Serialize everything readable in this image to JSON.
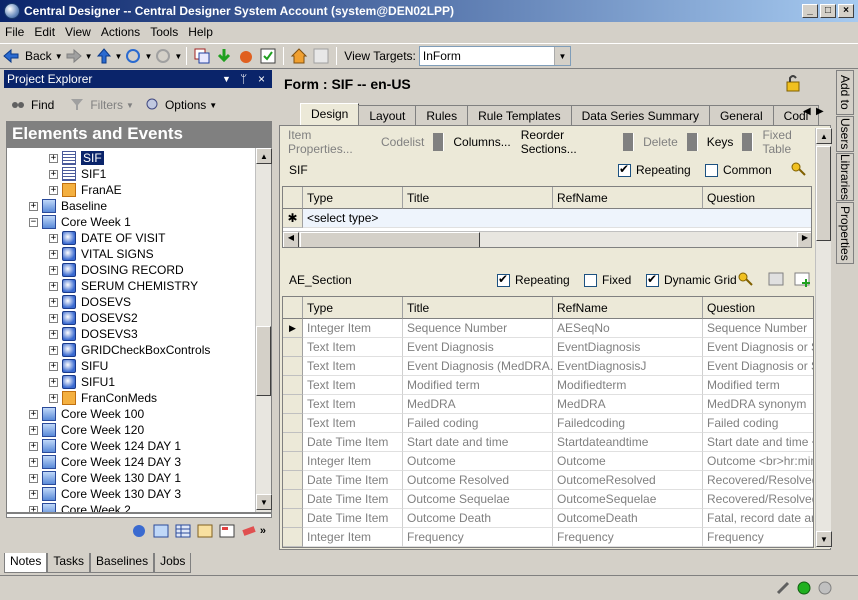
{
  "window": {
    "title": "Central Designer -- Central Designer System Account (system@DEN02LPP)",
    "minimize": "_",
    "maximize": "□",
    "close": "×"
  },
  "menu": [
    "File",
    "Edit",
    "View",
    "Actions",
    "Tools",
    "Help"
  ],
  "toolbar": {
    "back_label": "Back",
    "view_targets_label": "View Targets:",
    "view_targets_value": "InForm"
  },
  "project_explorer": {
    "title": "Project Explorer",
    "find_label": "Find",
    "filters_label": "Filters",
    "options_label": "Options",
    "section_title": "Elements and Events",
    "tree": [
      {
        "label": "SIF",
        "icon": "form-icon",
        "depth": 2,
        "selected": true
      },
      {
        "label": "SIF1",
        "icon": "form-icon",
        "depth": 2
      },
      {
        "label": "FranAE",
        "icon": "ae-icon",
        "depth": 2
      },
      {
        "label": "Baseline",
        "icon": "event-icon",
        "depth": 1
      },
      {
        "label": "Core Week 1",
        "icon": "event-icon",
        "depth": 1,
        "expanded": true
      },
      {
        "label": "DATE OF VISIT",
        "icon": "section-icon",
        "depth": 2
      },
      {
        "label": "VITAL SIGNS",
        "icon": "section-icon",
        "depth": 2
      },
      {
        "label": "DOSING RECORD",
        "icon": "section-icon",
        "depth": 2
      },
      {
        "label": "SERUM CHEMISTRY",
        "icon": "section-icon",
        "depth": 2
      },
      {
        "label": "DOSEVS",
        "icon": "section-icon",
        "depth": 2
      },
      {
        "label": "DOSEVS2",
        "icon": "section-icon",
        "depth": 2
      },
      {
        "label": "DOSEVS3",
        "icon": "section-icon",
        "depth": 2
      },
      {
        "label": "GRIDCheckBoxControls",
        "icon": "section-icon",
        "depth": 2
      },
      {
        "label": "SIFU",
        "icon": "section-icon",
        "depth": 2
      },
      {
        "label": "SIFU1",
        "icon": "section-icon",
        "depth": 2
      },
      {
        "label": "FranConMeds",
        "icon": "ae-icon",
        "depth": 2
      },
      {
        "label": "Core Week 100",
        "icon": "event-icon",
        "depth": 1
      },
      {
        "label": "Core Week 120",
        "icon": "event-icon",
        "depth": 1
      },
      {
        "label": "Core Week 124 DAY 1",
        "icon": "event-icon",
        "depth": 1
      },
      {
        "label": "Core Week 124 DAY 3",
        "icon": "event-icon",
        "depth": 1
      },
      {
        "label": "Core Week 130 DAY 1",
        "icon": "event-icon",
        "depth": 1
      },
      {
        "label": "Core Week 130 DAY 3",
        "icon": "event-icon",
        "depth": 1
      },
      {
        "label": "Core Week 2",
        "icon": "event-icon",
        "depth": 1
      }
    ]
  },
  "bottom_tabs": [
    "Notes",
    "Tasks",
    "Baselines",
    "Jobs"
  ],
  "form": {
    "title": "Form : SIF -- en-US",
    "tabs": [
      "Design",
      "Layout",
      "Rules",
      "Rule Templates",
      "Data Series Summary",
      "General",
      "Codi"
    ],
    "toolbar": {
      "item_properties": "Item Properties...",
      "codelist": "Codelist",
      "columns": "Columns...",
      "reorder": "Reorder Sections...",
      "delete": "Delete",
      "keys": "Keys",
      "fixed_table": "Fixed Table"
    },
    "section1": {
      "name": "SIF",
      "repeating_label": "Repeating",
      "common_label": "Common",
      "repeating": true,
      "common": false,
      "columns": [
        "Type",
        "Title",
        "RefName",
        "Question"
      ],
      "new_row": "<select type>"
    },
    "section2": {
      "name": "AE_Section",
      "repeating_label": "Repeating",
      "fixed_label": "Fixed",
      "dynamic_label": "Dynamic Grid",
      "repeating": true,
      "fixed": false,
      "dynamic": true,
      "columns": [
        "Type",
        "Title",
        "RefName",
        "Question"
      ],
      "rows": [
        [
          "Integer Item",
          "Sequence Number",
          "AESeqNo",
          "Sequence Number"
        ],
        [
          "Text Item",
          "Event Diagnosis",
          "EventDiagnosis",
          "Event Diagnosis or Si"
        ],
        [
          "Text Item",
          "Event Diagnosis  (MedDRA...",
          "EventDiagnosisJ",
          "Event Diagnosis or S"
        ],
        [
          "Text Item",
          "Modified term",
          "Modifiedterm",
          "Modified term"
        ],
        [
          "Text Item",
          "MedDRA",
          "MedDRA",
          "MedDRA synonym"
        ],
        [
          "Text Item",
          "Failed coding",
          "Failedcoding",
          "Failed coding"
        ],
        [
          "Date Time Item",
          "Start date and time",
          "Startdateandtime",
          "Start date  and time  <"
        ],
        [
          "Integer Item",
          "Outcome",
          "Outcome",
          "Outcome  <br>hr:min"
        ],
        [
          "Date Time Item",
          "Outcome Resolved",
          "OutcomeResolved",
          "Recovered/Resolved,"
        ],
        [
          "Date Time Item",
          "Outcome Sequelae",
          "OutcomeSequelae",
          "Recovered/Resolved"
        ],
        [
          "Date Time Item",
          "Outcome Death",
          "OutcomeDeath",
          "Fatal, record date and"
        ],
        [
          "Integer Item",
          "Frequency",
          "Frequency",
          "Frequency"
        ]
      ]
    }
  },
  "side_tabs": [
    "Add to",
    "Users",
    "Libraries",
    "Properties"
  ]
}
